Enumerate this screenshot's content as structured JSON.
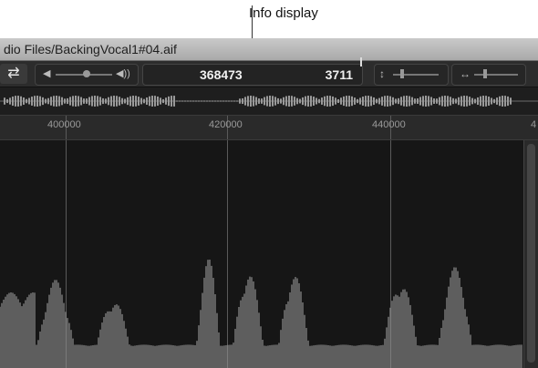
{
  "annotation": {
    "label": "Info display"
  },
  "window": {
    "title": "dio Files/BackingVocal1#04.aif"
  },
  "toolbar": {
    "info_display": {
      "left_value": "368473",
      "right_value": "3711"
    }
  },
  "ruler": {
    "ticks": [
      {
        "label": "400000"
      },
      {
        "label": "420000"
      },
      {
        "label": "440000"
      },
      {
        "label": "4"
      }
    ]
  },
  "icons": {
    "loop": "loop-icon",
    "volume_low": "speaker-low-icon",
    "volume_high": "speaker-high-icon",
    "vertical_zoom": "vertical-zoom-icon",
    "horizontal_zoom": "horizontal-zoom-icon"
  },
  "colors": {
    "waveform": "#8f8f8f",
    "background": "#161616",
    "title_bar": "#b8b8b8"
  }
}
